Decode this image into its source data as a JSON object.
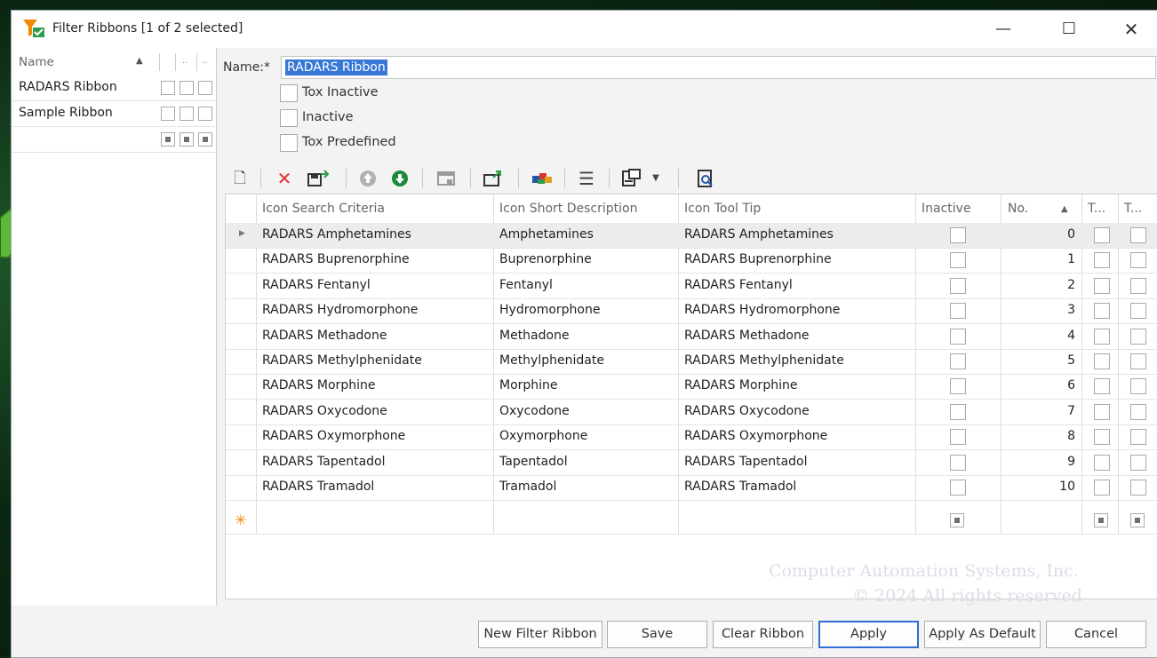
{
  "window": {
    "title": "Filter Ribbons [1 of 2 selected]",
    "controls": {
      "minimize": "—",
      "maximize": "☐",
      "close": "✕"
    }
  },
  "left_panel": {
    "header": {
      "name": "Name",
      "col2": "..",
      "col3": ".."
    },
    "rows": [
      {
        "label": "RADARS Ribbon"
      },
      {
        "label": "Sample Ribbon"
      },
      {
        "label": ""
      }
    ]
  },
  "form": {
    "name_label": "Name:*",
    "name_value": "RADARS Ribbon",
    "options": [
      {
        "label": "Tox Inactive",
        "checked": false
      },
      {
        "label": "Inactive",
        "checked": false
      },
      {
        "label": "Tox Predefined",
        "checked": false
      }
    ]
  },
  "toolbar": {
    "icons": [
      "new-icon",
      "delete-icon",
      "save-export-icon",
      "move-up-icon",
      "move-down-icon",
      "window-icon",
      "export-icon",
      "color-icon",
      "list-icon",
      "layout-icon",
      "dropdown-icon",
      "preview-icon"
    ]
  },
  "grid": {
    "columns": [
      "Icon Search Criteria",
      "Icon Short Description",
      "Icon Tool Tip",
      "Inactive",
      "No.",
      "T...",
      "T..."
    ],
    "rows": [
      {
        "search": "RADARS Amphetamines",
        "short": "Amphetamines",
        "tip": "RADARS Amphetamines",
        "no": "0"
      },
      {
        "search": "RADARS Buprenorphine",
        "short": "Buprenorphine",
        "tip": "RADARS Buprenorphine",
        "no": "1"
      },
      {
        "search": "RADARS Fentanyl",
        "short": "Fentanyl",
        "tip": "RADARS Fentanyl",
        "no": "2"
      },
      {
        "search": "RADARS Hydromorphone",
        "short": "Hydromorphone",
        "tip": "RADARS Hydromorphone",
        "no": "3"
      },
      {
        "search": "RADARS Methadone",
        "short": "Methadone",
        "tip": "RADARS Methadone",
        "no": "4"
      },
      {
        "search": "RADARS Methylphenidate",
        "short": "Methylphenidate",
        "tip": "RADARS Methylphenidate",
        "no": "5"
      },
      {
        "search": "RADARS Morphine",
        "short": "Morphine",
        "tip": "RADARS Morphine",
        "no": "6"
      },
      {
        "search": "RADARS Oxycodone",
        "short": "Oxycodone",
        "tip": "RADARS Oxycodone",
        "no": "7"
      },
      {
        "search": "RADARS Oxymorphone",
        "short": "Oxymorphone",
        "tip": "RADARS Oxymorphone",
        "no": "8"
      },
      {
        "search": "RADARS Tapentadol",
        "short": "Tapentadol",
        "tip": "RADARS Tapentadol",
        "no": "9"
      },
      {
        "search": "RADARS Tramadol",
        "short": "Tramadol",
        "tip": "RADARS Tramadol",
        "no": "10"
      }
    ]
  },
  "watermark": {
    "line1": "Computer Automation Systems, Inc.",
    "line2": "© 2024 All rights reserved"
  },
  "buttons": {
    "new_filter_ribbon": "New Filter Ribbon",
    "save": "Save",
    "clear_ribbon": "Clear Ribbon",
    "apply": "Apply",
    "apply_as_default": "Apply As Default",
    "cancel": "Cancel"
  },
  "colors": {
    "accent": "#2f6fd1",
    "selection": "#3778d7",
    "arrow": "#5cb83a",
    "background": "#0d2a14"
  }
}
